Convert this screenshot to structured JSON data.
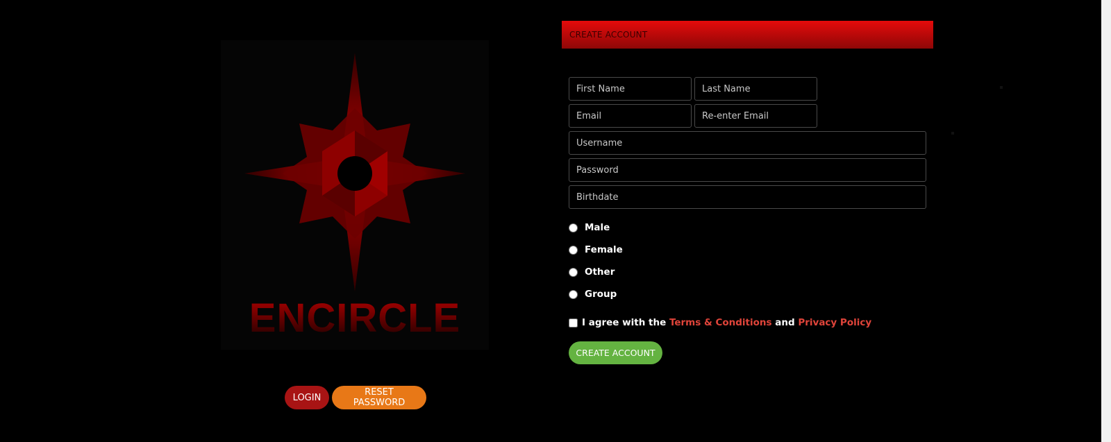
{
  "logo": {
    "icon": "encircle-star-logo",
    "wordmark": "ENCIRCLE",
    "colors": {
      "primary": "#b30000",
      "dark": "#3a0000"
    }
  },
  "left_actions": {
    "login_label": "LOGIN",
    "reset_label": "RESET PASSWORD"
  },
  "form": {
    "header": "CREATE ACCOUNT",
    "fields": {
      "first_name": {
        "placeholder": "First Name",
        "value": ""
      },
      "last_name": {
        "placeholder": "Last Name",
        "value": ""
      },
      "email": {
        "placeholder": "Email",
        "value": ""
      },
      "reenter_email": {
        "placeholder": "Re-enter Email",
        "value": ""
      },
      "username": {
        "placeholder": "Username",
        "value": ""
      },
      "password": {
        "placeholder": "Password",
        "value": ""
      },
      "birthdate": {
        "placeholder": "Birthdate",
        "value": ""
      }
    },
    "gender_options": [
      "Male",
      "Female",
      "Other",
      "Group"
    ],
    "agree": {
      "prefix": "I agree with the",
      "terms": "Terms & Conditions",
      "and": "and",
      "privacy": "Privacy Policy",
      "checked": false
    },
    "submit_label": "CREATE ACCOUNT"
  },
  "colors": {
    "header_red": "#e50b0b",
    "login_red": "#a81414",
    "reset_orange": "#e87817",
    "submit_green": "#64b341",
    "link_red": "#e0443a"
  }
}
